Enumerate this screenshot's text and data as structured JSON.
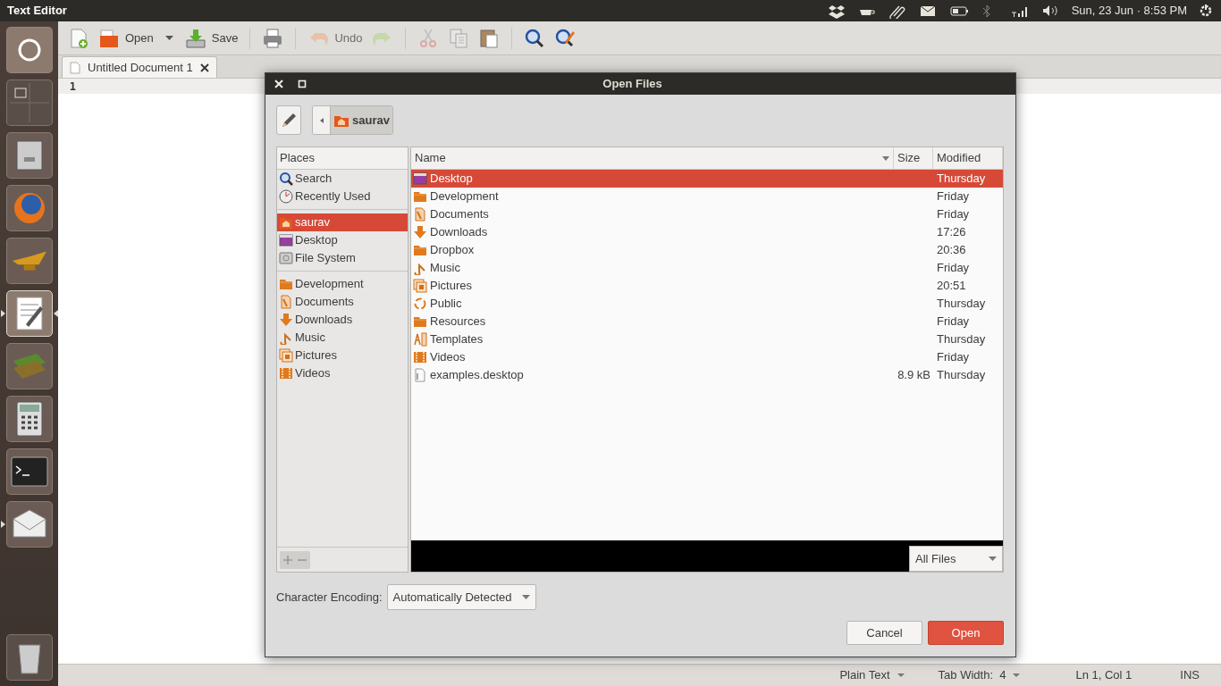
{
  "top_panel": {
    "app_title": "Text Editor",
    "clock": "Sun, 23 Jun · 8:53 PM"
  },
  "launcher": [
    {
      "kind": "dash",
      "running": false,
      "focused": false
    },
    {
      "kind": "workspaces",
      "running": false,
      "focused": false
    },
    {
      "kind": "files",
      "running": false,
      "focused": false
    },
    {
      "kind": "browser",
      "running": false,
      "focused": false
    },
    {
      "kind": "lamp",
      "running": false,
      "focused": false
    },
    {
      "kind": "editor",
      "running": true,
      "focused": true
    },
    {
      "kind": "books",
      "running": false,
      "focused": false
    },
    {
      "kind": "calculator",
      "running": false,
      "focused": false
    },
    {
      "kind": "terminal",
      "running": false,
      "focused": false
    },
    {
      "kind": "mail",
      "running": true,
      "focused": false
    },
    {
      "kind": "trash",
      "running": false,
      "focused": false
    }
  ],
  "toolbar": [
    {
      "kind": "new",
      "disabled": false
    },
    {
      "kind": "open",
      "label": "Open",
      "disabled": false
    },
    {
      "kind": "menu",
      "disabled": false
    },
    {
      "kind": "save",
      "label": "Save",
      "disabled": false
    },
    {
      "kind": "separator"
    },
    {
      "kind": "print",
      "disabled": false
    },
    {
      "kind": "separator"
    },
    {
      "kind": "undo",
      "label": "Undo",
      "disabled": true
    },
    {
      "kind": "redo",
      "disabled": true
    },
    {
      "kind": "separator"
    },
    {
      "kind": "cut",
      "disabled": true
    },
    {
      "kind": "copy",
      "disabled": true
    },
    {
      "kind": "paste",
      "disabled": false
    },
    {
      "kind": "separator"
    },
    {
      "kind": "find",
      "disabled": false
    },
    {
      "kind": "replace",
      "disabled": false
    }
  ],
  "tabs": [
    {
      "label": "Untitled Document 1",
      "selected": true
    }
  ],
  "editor": {
    "line_numbers": [
      "1"
    ]
  },
  "dialog": {
    "title": "Open Files",
    "path": [
      {
        "label": "saurav",
        "selected": true
      }
    ],
    "places_header": "Places",
    "places": [
      {
        "kind": "search",
        "label": "Search",
        "selected": false
      },
      {
        "kind": "recent",
        "label": "Recently Used",
        "selected": false
      },
      {
        "kind": "separator"
      },
      {
        "kind": "home",
        "label": "saurav",
        "selected": true
      },
      {
        "kind": "desktop",
        "label": "Desktop",
        "selected": false
      },
      {
        "kind": "drive",
        "label": "File System",
        "selected": false
      },
      {
        "kind": "separator"
      },
      {
        "kind": "folder",
        "label": "Development",
        "selected": false
      },
      {
        "kind": "documents",
        "label": "Documents",
        "selected": false
      },
      {
        "kind": "downloads",
        "label": "Downloads",
        "selected": false
      },
      {
        "kind": "music",
        "label": "Music",
        "selected": false
      },
      {
        "kind": "pictures",
        "label": "Pictures",
        "selected": false
      },
      {
        "kind": "videos",
        "label": "Videos",
        "selected": false
      }
    ],
    "columns": [
      "Name",
      "Size",
      "Modified"
    ],
    "files": [
      {
        "kind": "desktop",
        "name": "Desktop",
        "modified": "Thursday",
        "selected": true
      },
      {
        "kind": "folder",
        "name": "Development",
        "modified": "Friday",
        "selected": false
      },
      {
        "kind": "documents",
        "name": "Documents",
        "modified": "Friday",
        "selected": false
      },
      {
        "kind": "downloads",
        "name": "Downloads",
        "modified": "17:26",
        "selected": false
      },
      {
        "kind": "folder",
        "name": "Dropbox",
        "modified": "20:36",
        "selected": false
      },
      {
        "kind": "music",
        "name": "Music",
        "modified": "Friday",
        "selected": false
      },
      {
        "kind": "pictures",
        "name": "Pictures",
        "modified": "20:51",
        "selected": false
      },
      {
        "kind": "public",
        "name": "Public",
        "modified": "Thursday",
        "selected": false
      },
      {
        "kind": "folder",
        "name": "Resources",
        "modified": "Friday",
        "selected": false
      },
      {
        "kind": "templates",
        "name": "Templates",
        "modified": "Thursday",
        "selected": false
      },
      {
        "kind": "videos",
        "name": "Videos",
        "modified": "Friday",
        "selected": false
      },
      {
        "kind": "file",
        "name": "examples.desktop",
        "size": "8.9 kB",
        "modified": "Thursday",
        "selected": false
      }
    ],
    "filter": "All Files",
    "encoding_label": "Character Encoding:",
    "encoding": "Automatically Detected",
    "buttons": [
      {
        "kind": "secondary",
        "label": "Cancel"
      },
      {
        "kind": "primary",
        "label": "Open"
      }
    ]
  },
  "status_bar": {
    "language": "Plain Text",
    "tab_width": "Tab Width:  4",
    "position": "Ln 1, Col 1",
    "mode": "INS"
  }
}
